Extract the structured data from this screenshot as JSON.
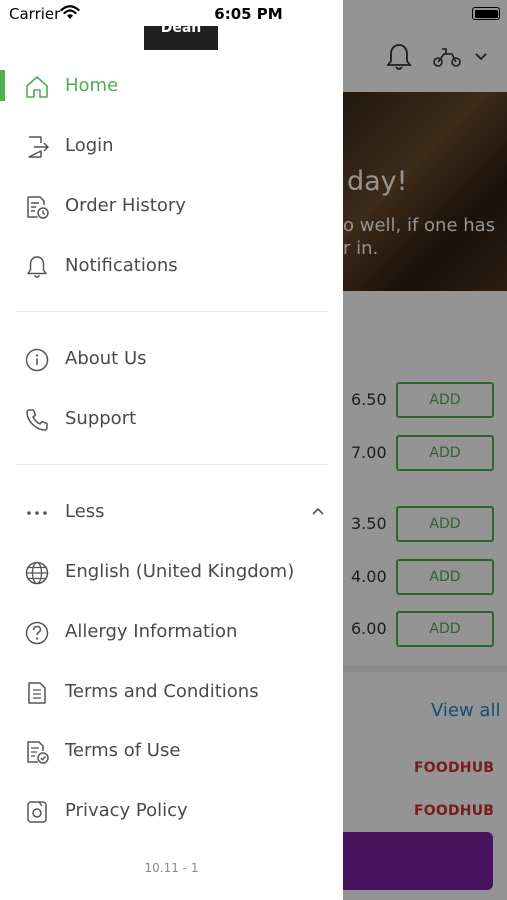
{
  "status_bar": {
    "carrier": "Carrier",
    "time": "6:05 PM"
  },
  "drawer": {
    "logo_text": "Dean",
    "primary_items": [
      {
        "label": "Home",
        "icon": "home-icon",
        "active": true
      },
      {
        "label": "Login",
        "icon": "login-icon"
      },
      {
        "label": "Order History",
        "icon": "order-history-icon"
      },
      {
        "label": "Notifications",
        "icon": "bell-icon"
      }
    ],
    "secondary_items": [
      {
        "label": "About Us",
        "icon": "info-icon"
      },
      {
        "label": "Support",
        "icon": "phone-icon"
      }
    ],
    "more_toggle": {
      "label": "Less",
      "icon": "ellipsis-icon",
      "expanded": true
    },
    "more_items": [
      {
        "label": "English (United Kingdom)",
        "icon": "globe-icon"
      },
      {
        "label": "Allergy Information",
        "icon": "question-icon"
      },
      {
        "label": "Terms and Conditions",
        "icon": "document-icon"
      },
      {
        "label": "Terms of Use",
        "icon": "document-check-icon"
      },
      {
        "label": "Privacy Policy",
        "icon": "privacy-icon"
      }
    ],
    "version": "10.11 - 1",
    "accent_color": "#4caf50"
  },
  "background": {
    "hero_title": "day!",
    "hero_subtitle": "o well, if one has\nr in.",
    "items": [
      {
        "price": "6.50",
        "button": "ADD"
      },
      {
        "price": "7.00",
        "button": "ADD"
      },
      {
        "price": "3.50",
        "button": "ADD"
      },
      {
        "price": "4.00",
        "button": "ADD"
      },
      {
        "price": "6.00",
        "button": "ADD"
      }
    ],
    "view_all": "View all",
    "brand_labels": [
      "FOODHUB",
      "FOODHUB"
    ]
  }
}
